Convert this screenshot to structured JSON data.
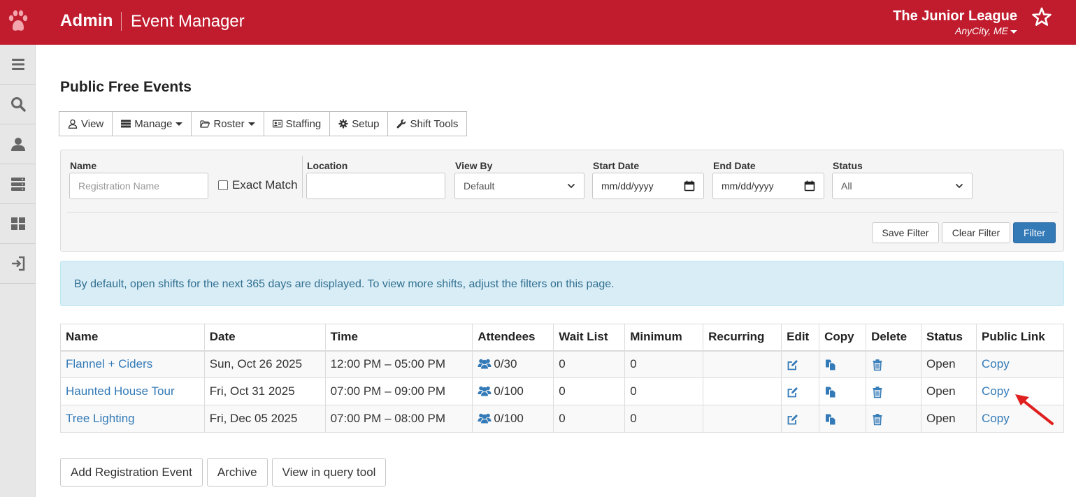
{
  "header": {
    "brand": "Admin",
    "subtitle": "Event Manager",
    "org_name": "The Junior League",
    "org_city": "AnyCity, ME",
    "colors": {
      "brand_bar": "#c01c2e",
      "link": "#337ab7",
      "primary_button": "#337ab7"
    }
  },
  "sidebar": {
    "items": [
      {
        "icon": "menu-icon"
      },
      {
        "icon": "search-icon"
      },
      {
        "icon": "user-icon"
      },
      {
        "icon": "server-icon"
      },
      {
        "icon": "dashboard-icon"
      },
      {
        "icon": "sign-in-icon"
      }
    ]
  },
  "page": {
    "title": "Public Free Events"
  },
  "toolbar": {
    "view": "View",
    "manage": "Manage",
    "roster": "Roster",
    "staffing": "Staffing",
    "setup": "Setup",
    "shift_tools": "Shift Tools"
  },
  "filters": {
    "name_label": "Name",
    "name_placeholder": "Registration Name",
    "exact_match": "Exact Match",
    "location_label": "Location",
    "location_value": "",
    "view_by_label": "View By",
    "view_by_value": "Default",
    "start_date_label": "Start Date",
    "start_date_value": "mm/dd/yyyy",
    "end_date_label": "End Date",
    "end_date_value": "mm/dd/yyyy",
    "status_label": "Status",
    "status_value": "All",
    "save_filter": "Save Filter",
    "clear_filter": "Clear Filter",
    "filter": "Filter"
  },
  "alert": {
    "text": "By default, open shifts for the next 365 days are displayed. To view more shifts, adjust the filters on this page."
  },
  "table": {
    "headers": [
      "Name",
      "Date",
      "Time",
      "Attendees",
      "Wait List",
      "Minimum",
      "Recurring",
      "Edit",
      "Copy",
      "Delete",
      "Status",
      "Public Link"
    ],
    "rows": [
      {
        "name": "Flannel + Ciders",
        "date": "Sun, Oct 26 2025",
        "time": "12:00 PM – 05:00 PM",
        "attendees": "0/30",
        "wait_list": "0",
        "minimum": "0",
        "recurring": "",
        "status": "Open",
        "public_link": "Copy"
      },
      {
        "name": "Haunted House Tour",
        "date": "Fri, Oct 31 2025",
        "time": "07:00 PM – 09:00 PM",
        "attendees": "0/100",
        "wait_list": "0",
        "minimum": "0",
        "recurring": "",
        "status": "Open",
        "public_link": "Copy"
      },
      {
        "name": "Tree Lighting",
        "date": "Fri, Dec 05 2025",
        "time": "07:00 PM – 08:00 PM",
        "attendees": "0/100",
        "wait_list": "0",
        "minimum": "0",
        "recurring": "",
        "status": "Open",
        "public_link": "Copy"
      }
    ]
  },
  "actions": {
    "add_event": "Add Registration Event",
    "archive": "Archive",
    "query_tool": "View in query tool"
  }
}
